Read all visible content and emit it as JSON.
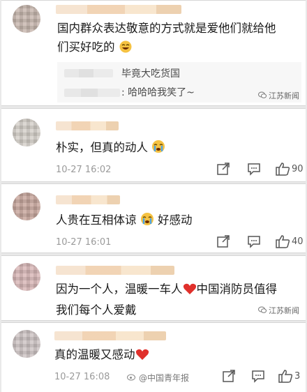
{
  "comments": [
    {
      "text_line1": "国内群众表达敬意的方式就是爱他们就给他",
      "text_line2": "们买好吃的",
      "replies": [
        {
          "text": "毕竟大吃货国"
        },
        {
          "text": ": 哈哈哈我笑了~"
        }
      ],
      "watermark": "江苏新闻"
    },
    {
      "text": "朴实，但真的动人",
      "time": "10-27 16:02",
      "likes": "90"
    },
    {
      "text_before": "人贵在互相体谅",
      "text_after": "好感动",
      "time": "10-27 16:01",
      "likes": "40"
    },
    {
      "text_line1": "因为一个人，温暖一车人",
      "text_line1_b": "中国消防员值得",
      "text_line2": "我们每个人爱戴",
      "watermark": "江苏新闻"
    },
    {
      "text": "真的温暖又感动",
      "time": "10-27 16:08",
      "likes": "3"
    }
  ],
  "bottom_watermark": "@中国青年报",
  "colors": {
    "heart": "#e0302b",
    "emoji": "#f5c242",
    "meta": "#9a9a9a"
  }
}
